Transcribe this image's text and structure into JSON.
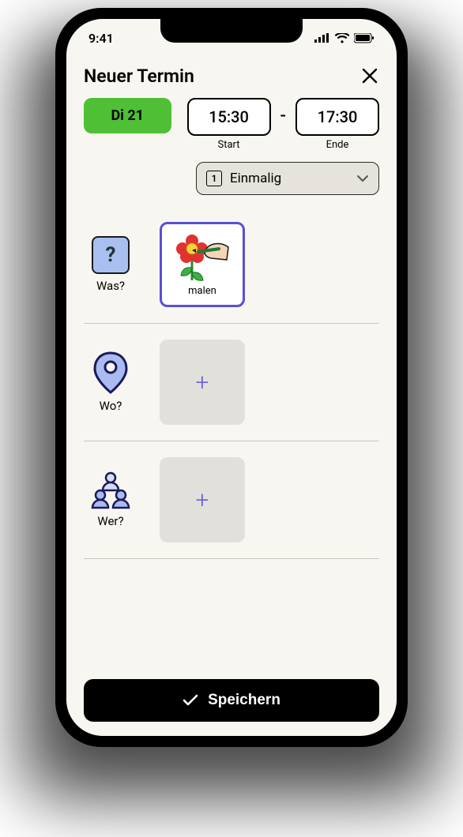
{
  "status": {
    "time": "9:41"
  },
  "header": {
    "title": "Neuer Termin"
  },
  "date": {
    "chip": "Di 21"
  },
  "time": {
    "start_value": "15:30",
    "start_label": "Start",
    "end_value": "17:30",
    "end_label": "Ende"
  },
  "recurrence": {
    "badge": "1",
    "label": "Einmalig"
  },
  "rows": {
    "what": {
      "label": "Was?",
      "selected_label": "malen"
    },
    "where": {
      "label": "Wo?"
    },
    "who": {
      "label": "Wer?"
    }
  },
  "footer": {
    "save": "Speichern"
  }
}
